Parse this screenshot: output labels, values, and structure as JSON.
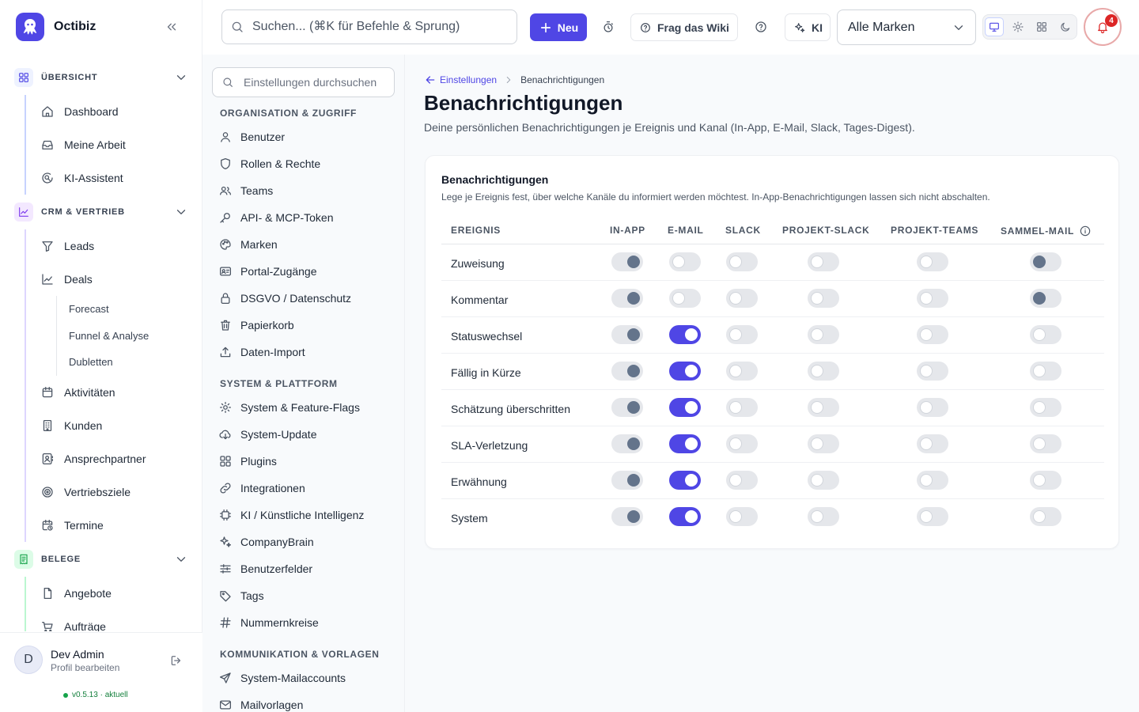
{
  "app": {
    "name": "Octibiz"
  },
  "nav": {
    "sections": [
      {
        "label": "ÜBERSICHT",
        "icon": "grid-icon",
        "color": "#4f46e5",
        "line": "#c7d2fe",
        "items": [
          {
            "label": "Dashboard",
            "icon": "home-icon"
          },
          {
            "label": "Meine Arbeit",
            "icon": "inbox-icon"
          },
          {
            "label": "KI-Assistent",
            "icon": "chat-search-icon"
          }
        ]
      },
      {
        "label": "CRM & VERTRIEB",
        "icon": "chart-icon",
        "color": "#7c3aed",
        "line": "#ddd6fe",
        "items": [
          {
            "label": "Leads",
            "icon": "funnel-icon"
          },
          {
            "label": "Deals",
            "icon": "trend-icon"
          }
        ],
        "subitems": [
          "Forecast",
          "Funnel & Analyse",
          "Dubletten"
        ],
        "items2": [
          {
            "label": "Aktivitäten",
            "icon": "calendar-icon"
          },
          {
            "label": "Kunden",
            "icon": "building-icon"
          },
          {
            "label": "Ansprechpartner",
            "icon": "contact-icon"
          },
          {
            "label": "Vertriebsziele",
            "icon": "target-icon"
          },
          {
            "label": "Termine",
            "icon": "calendar-clock-icon"
          }
        ]
      },
      {
        "label": "BELEGE",
        "icon": "receipt-icon",
        "color": "#16a34a",
        "line": "#bbf7d0",
        "items": [
          {
            "label": "Angebote",
            "icon": "file-icon"
          },
          {
            "label": "Aufträge",
            "icon": "cart-icon"
          }
        ]
      }
    ]
  },
  "user": {
    "initial": "D",
    "name": "Dev Admin",
    "subtitle": "Profil bearbeiten",
    "version": "v0.5.13 · aktuell"
  },
  "topbar": {
    "search_placeholder": "Suchen... (⌘K für Befehle & Sprung)",
    "new_label": "Neu",
    "wiki_label": "Frag das Wiki",
    "ai_label": "KI",
    "brand_select": "Alle Marken",
    "notifications_count": "4"
  },
  "settings": {
    "search_placeholder": "Einstellungen durchsuchen",
    "groups": [
      {
        "title": "ORGANISATION & ZUGRIFF",
        "items": [
          {
            "label": "Benutzer",
            "icon": "user-icon"
          },
          {
            "label": "Rollen & Rechte",
            "icon": "shield-icon"
          },
          {
            "label": "Teams",
            "icon": "users-icon"
          },
          {
            "label": "API- & MCP-Token",
            "icon": "key-icon"
          },
          {
            "label": "Marken",
            "icon": "palette-icon"
          },
          {
            "label": "Portal-Zugänge",
            "icon": "id-card-icon"
          },
          {
            "label": "DSGVO / Datenschutz",
            "icon": "lock-icon"
          },
          {
            "label": "Papierkorb",
            "icon": "trash-icon"
          },
          {
            "label": "Daten-Import",
            "icon": "upload-icon"
          }
        ]
      },
      {
        "title": "SYSTEM & PLATTFORM",
        "items": [
          {
            "label": "System & Feature-Flags",
            "icon": "gear-icon"
          },
          {
            "label": "System-Update",
            "icon": "cloud-download-icon"
          },
          {
            "label": "Plugins",
            "icon": "grid-icon"
          },
          {
            "label": "Integrationen",
            "icon": "link-icon"
          },
          {
            "label": "KI / Künstliche Intelligenz",
            "icon": "chip-icon"
          },
          {
            "label": "CompanyBrain",
            "icon": "sparkles-icon"
          },
          {
            "label": "Benutzerfelder",
            "icon": "sliders-icon"
          },
          {
            "label": "Tags",
            "icon": "tag-icon"
          },
          {
            "label": "Nummernkreise",
            "icon": "hash-icon"
          }
        ]
      },
      {
        "title": "KOMMUNIKATION & VORLAGEN",
        "items": [
          {
            "label": "System-Mailaccounts",
            "icon": "send-icon"
          },
          {
            "label": "Mailvorlagen",
            "icon": "mail-icon"
          }
        ]
      }
    ]
  },
  "page": {
    "breadcrumb_back": "Einstellungen",
    "breadcrumb_current": "Benachrichtigungen",
    "title": "Benachrichtigungen",
    "description": "Deine persönlichen Benachrichtigungen je Ereignis und Kanal (In-App, E-Mail, Slack, Tages-Digest)."
  },
  "card": {
    "title": "Benachrichtigungen",
    "description": "Lege je Ereignis fest, über welche Kanäle du informiert werden möchtest. In-App-Benachrichtigungen lassen sich nicht abschalten.",
    "columns": [
      "EREIGNIS",
      "IN-APP",
      "E-MAIL",
      "SLACK",
      "PROJEKT-SLACK",
      "PROJEKT-TEAMS",
      "SAMMEL-MAIL"
    ],
    "rows": [
      {
        "event": "Zuweisung",
        "in_app": true,
        "email": false,
        "slack": false,
        "project_slack": false,
        "project_teams": false,
        "digest": true
      },
      {
        "event": "Kommentar",
        "in_app": true,
        "email": false,
        "slack": false,
        "project_slack": false,
        "project_teams": false,
        "digest": true
      },
      {
        "event": "Statuswechsel",
        "in_app": true,
        "email": true,
        "slack": false,
        "project_slack": false,
        "project_teams": false,
        "digest": false
      },
      {
        "event": "Fällig in Kürze",
        "in_app": true,
        "email": true,
        "slack": false,
        "project_slack": false,
        "project_teams": false,
        "digest": false
      },
      {
        "event": "Schätzung überschritten",
        "in_app": true,
        "email": true,
        "slack": false,
        "project_slack": false,
        "project_teams": false,
        "digest": false
      },
      {
        "event": "SLA-Verletzung",
        "in_app": true,
        "email": true,
        "slack": false,
        "project_slack": false,
        "project_teams": false,
        "digest": false
      },
      {
        "event": "Erwähnung",
        "in_app": true,
        "email": true,
        "slack": false,
        "project_slack": false,
        "project_teams": false,
        "digest": false
      },
      {
        "event": "System",
        "in_app": true,
        "email": true,
        "slack": false,
        "project_slack": false,
        "project_teams": false,
        "digest": false
      }
    ]
  },
  "colors": {
    "accent": "#4f46e5",
    "danger": "#dc2626",
    "success": "#16a34a"
  }
}
